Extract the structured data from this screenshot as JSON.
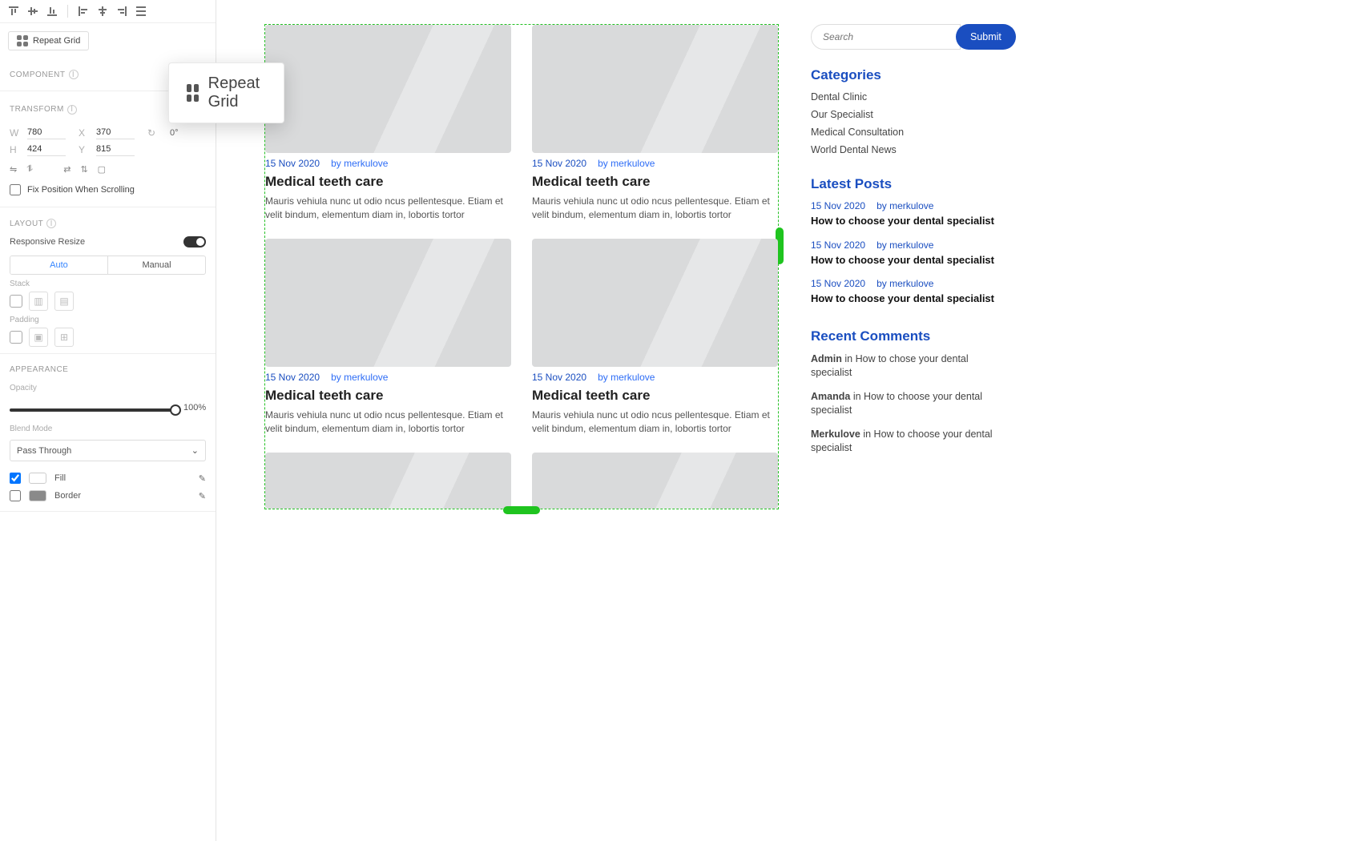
{
  "inspector": {
    "repeat_grid_pill": "Repeat Grid",
    "repeat_grid_callout": "Repeat Grid",
    "sections": {
      "component": "COMPONENT",
      "transform": "TRANSFORM",
      "layout": "LAYOUT",
      "appearance": "APPEARANCE"
    },
    "transform": {
      "w_label": "W",
      "w": "780",
      "x_label": "X",
      "x": "370",
      "h_label": "H",
      "h": "424",
      "y_label": "Y",
      "y": "815",
      "rotate_label": "0°"
    },
    "fix_position": "Fix Position When Scrolling",
    "responsive_resize_label": "Responsive Resize",
    "seg_auto": "Auto",
    "seg_manual": "Manual",
    "stack_label": "Stack",
    "padding_label": "Padding",
    "opacity_label": "Opacity",
    "opacity_value": "100%",
    "blend_label": "Blend Mode",
    "blend_value": "Pass Through",
    "fill_label": "Fill",
    "border_label": "Border"
  },
  "post": {
    "date": "15 Nov 2020",
    "byline": "by merkulove",
    "title": "Medical teeth care",
    "excerpt": "Mauris vehiula nunc ut odio ncus pellentesque. Etiam et velit bindum, elementum diam in, lobortis tortor"
  },
  "sidebar": {
    "search_placeholder": "Search",
    "submit": "Submit",
    "categories_title": "Categories",
    "categories": [
      "Dental Clinic",
      "Our Specialist",
      "Medical Consultation",
      "World Dental News"
    ],
    "latest_title": "Latest Posts",
    "latest_post": {
      "date": "15 Nov 2020",
      "byline": "by merkulove",
      "title": "How to choose your dental specialist"
    },
    "recent_title": "Recent Comments",
    "comments": [
      {
        "author": "Admin",
        "sep": "in",
        "post": "How to chose your dental specialist"
      },
      {
        "author": "Amanda",
        "sep": "in",
        "post": "How to choose your dental specialist"
      },
      {
        "author": "Merkulove",
        "sep": "in",
        "post": "How to choose your dental specialist"
      }
    ]
  }
}
